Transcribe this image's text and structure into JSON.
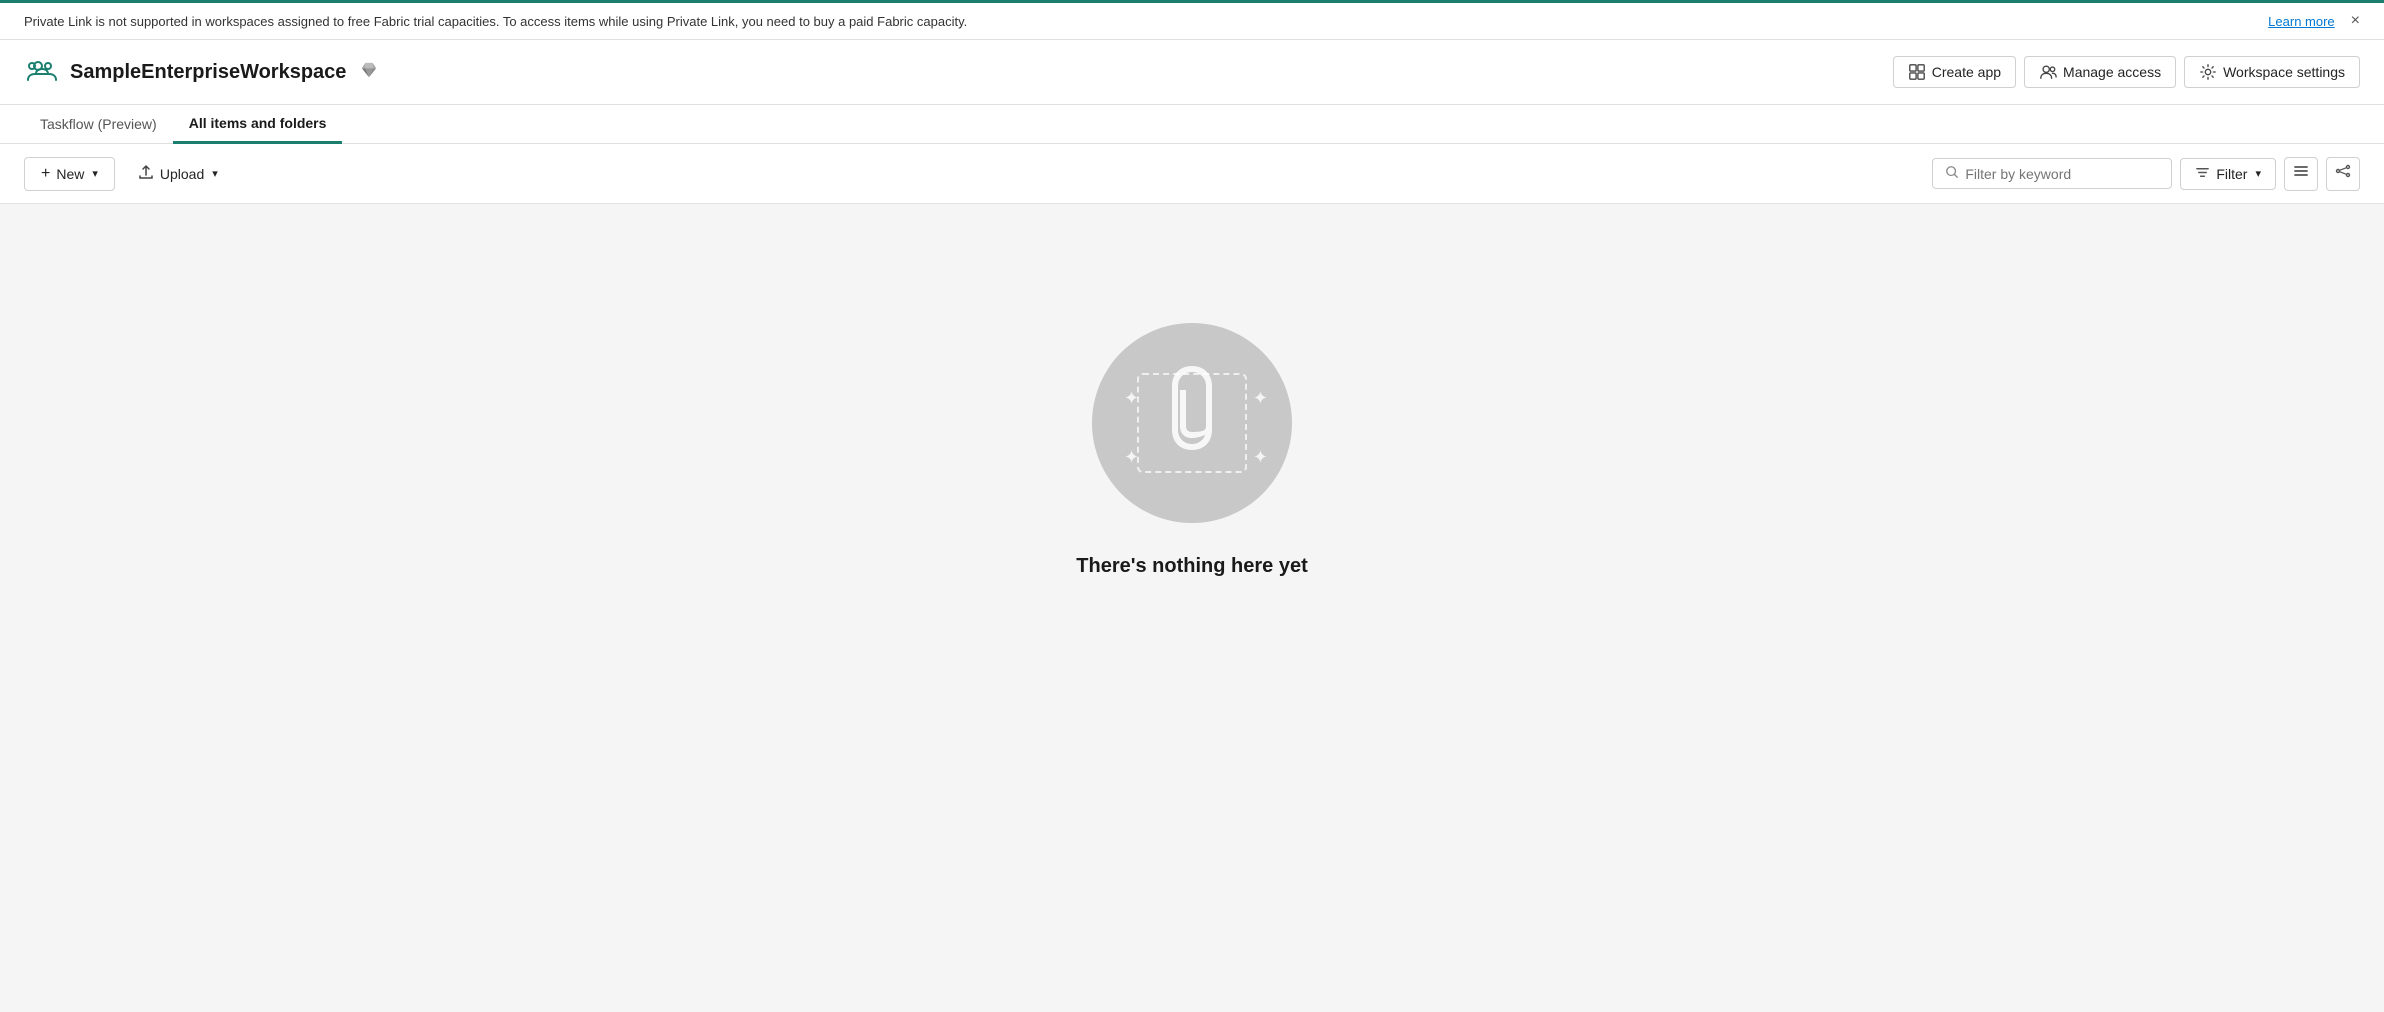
{
  "banner": {
    "text": "Private Link is not supported in workspaces assigned to free Fabric trial capacities. To access items while using Private Link, you need to buy a paid Fabric capacity.",
    "learn_more_label": "Learn more",
    "close_label": "×"
  },
  "header": {
    "workspace_name": "SampleEnterpriseWorkspace",
    "create_app_label": "Create app",
    "manage_access_label": "Manage access",
    "workspace_settings_label": "Workspace settings"
  },
  "tabs": [
    {
      "id": "taskflow",
      "label": "Taskflow (Preview)",
      "active": false
    },
    {
      "id": "all-items",
      "label": "All items and folders",
      "active": true
    }
  ],
  "toolbar": {
    "new_label": "New",
    "upload_label": "Upload",
    "filter_by_keyword_placeholder": "Filter by keyword",
    "filter_label": "Filter"
  },
  "empty_state": {
    "title": "There's nothing here yet"
  },
  "icons": {
    "workspace": "👥",
    "diamond": "◆",
    "create_app": "🎁",
    "manage_access": "👥",
    "workspace_settings": "⚙",
    "chevron_down": "∨",
    "upload_arrow": "↑",
    "search": "🔍",
    "filter_lines": "≡",
    "list_view": "☰",
    "share": "⧉",
    "plus": "+"
  },
  "colors": {
    "accent": "#1a7f6e",
    "link": "#0078d4"
  }
}
